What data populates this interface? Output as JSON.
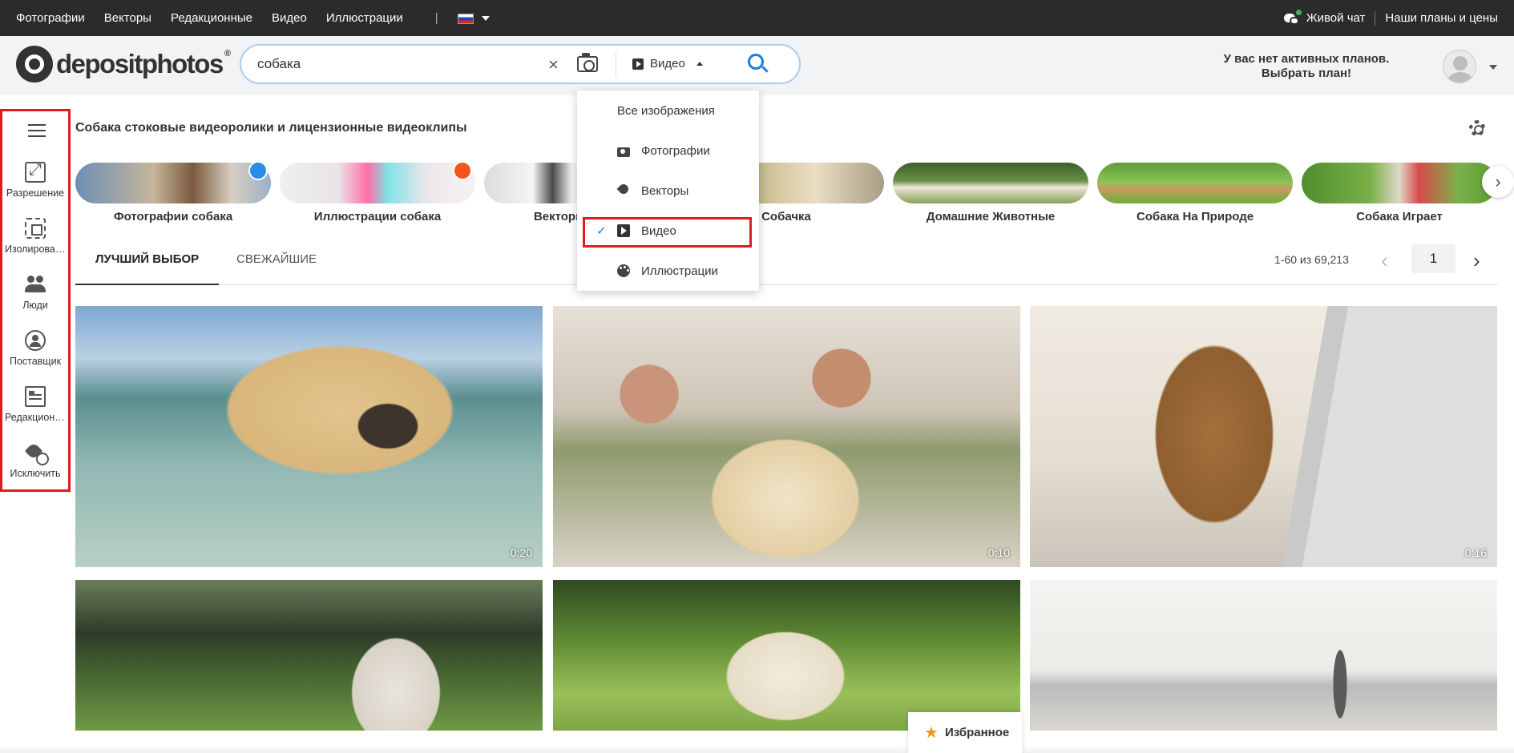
{
  "topbar": {
    "nav": [
      "Фотографии",
      "Векторы",
      "Редакционные",
      "Видео",
      "Иллюстрации"
    ],
    "separator": "|",
    "live_chat": "Живой чат",
    "plans": "Наши планы и цены"
  },
  "header": {
    "logo_text": "depositphotos",
    "logo_reg": "®",
    "search_value": "собака",
    "clear_symbol": "×",
    "type_label": "Видео",
    "plan_line1": "У вас нет активных планов.",
    "plan_line2": "Выбрать план!"
  },
  "sidebar": {
    "items": [
      {
        "label": "Разрешение",
        "icon": "resize-icon"
      },
      {
        "label": "Изолированные",
        "icon": "isolate-icon"
      },
      {
        "label": "Люди",
        "icon": "people-icon"
      },
      {
        "label": "Поставщик",
        "icon": "contributor-icon"
      },
      {
        "label": "Редакционные",
        "icon": "editorial-icon"
      },
      {
        "label": "Исключить",
        "icon": "exclude-icon"
      }
    ]
  },
  "page_title": "Собака стоковые видеоролики и лицензионные видеоклипы",
  "categories": [
    {
      "name": "Фотографии собака",
      "badge_color": "#2a8ce6"
    },
    {
      "name": "Иллюстрации собака",
      "badge_color": "#f2561d"
    },
    {
      "name": "Векторы собака"
    },
    {
      "name": "Собачка"
    },
    {
      "name": "Домашние Животные"
    },
    {
      "name": "Собака На Природе"
    },
    {
      "name": "Собака Играет"
    }
  ],
  "tabs": [
    "ЛУЧШИЙ ВЫБОР",
    "СВЕЖАЙШИЕ"
  ],
  "pager": {
    "range_text": "1-60 из 69,213",
    "current_page": "1",
    "prev": "‹",
    "next": "›"
  },
  "tiles": [
    {
      "duration": "0:20"
    },
    {
      "duration": "0:10"
    },
    {
      "duration": "0:16"
    },
    {
      "duration": ""
    },
    {
      "duration": ""
    },
    {
      "duration": ""
    }
  ],
  "dropdown": {
    "items": [
      {
        "label": "Все изображения",
        "selected": false
      },
      {
        "label": "Фотографии",
        "selected": false
      },
      {
        "label": "Векторы",
        "selected": false
      },
      {
        "label": "Видео",
        "selected": true
      },
      {
        "label": "Иллюстрации",
        "selected": false
      }
    ],
    "check": "✓"
  },
  "favorites": "Избранное",
  "colors": {
    "topbar": "#2b2b2b",
    "accent_blue": "#1c7de1",
    "highlight_red": "#e11b22",
    "star": "#f7941d"
  }
}
